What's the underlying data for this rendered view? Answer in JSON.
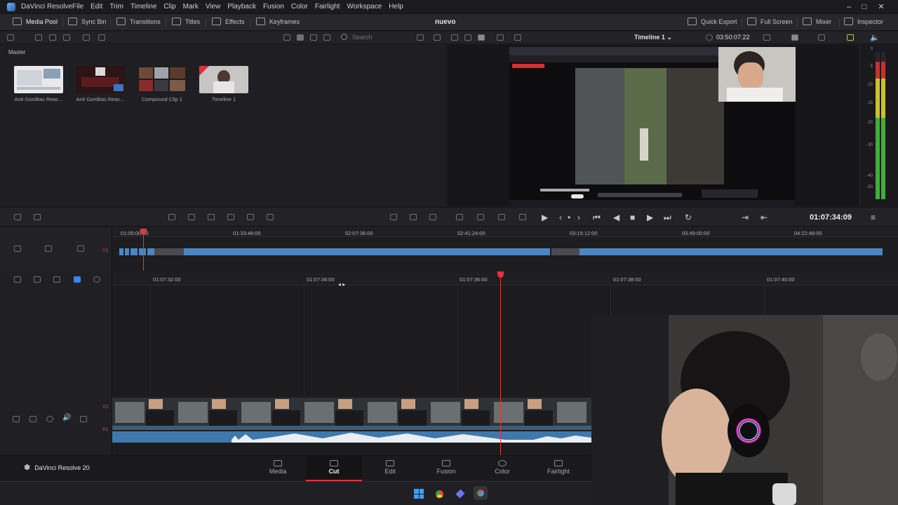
{
  "app": {
    "title": "DaVinci Resolve",
    "menu": [
      "File",
      "Edit",
      "Trim",
      "Timeline",
      "Clip",
      "Mark",
      "View",
      "Playback",
      "Fusion",
      "Color",
      "Fairlight",
      "Workspace",
      "Help"
    ],
    "window_controls": [
      "minimize-icon",
      "maximize-icon",
      "close-icon"
    ]
  },
  "toolbar": {
    "media_pool": "Media Pool",
    "sync_bin": "Sync Bin",
    "transitions": "Transitions",
    "titles": "Titles",
    "effects": "Effects",
    "keyframes": "Keyframes",
    "project_title": "nuevo",
    "quick_export": "Quick Export",
    "full_screen": "Full Screen",
    "mixer": "Mixer",
    "inspector": "Inspector"
  },
  "subbar": {
    "search_placeholder": "Search",
    "timeline_name": "Timeline 1",
    "timecode": "03:50:07:22"
  },
  "media_pool": {
    "bin": "Master",
    "clips": [
      {
        "name": "Anti Gorditas Reac..."
      },
      {
        "name": "Anti Gorditas Reac..."
      },
      {
        "name": "Compound Clip 1"
      },
      {
        "name": "Timeline 1"
      }
    ]
  },
  "viewer": {
    "meter_scale": [
      "0",
      "-5",
      "-10",
      "-15",
      "-20",
      "-30",
      "-40",
      "-50"
    ]
  },
  "transport": {
    "timecode": "01:07:34:09"
  },
  "upper_ruler": {
    "labels": [
      "01:00:00:00",
      "01:33:48:00",
      "02:07:36:00",
      "02:41:24:00",
      "03:15:12:00",
      "03:49:00:00",
      "04:22:48:00"
    ],
    "track": "V1"
  },
  "lower_ruler": {
    "labels": [
      "01:07:32:00",
      "01:07:34:00",
      "01:07:36:00",
      "01:07:38:00",
      "01:07:40:00"
    ],
    "video_track": "V1",
    "audio_track": "A1"
  },
  "pages": {
    "brand": "DaVinci Resolve 20",
    "tabs": [
      "Media",
      "Cut",
      "Edit",
      "Fusion",
      "Color",
      "Fairlight"
    ],
    "active": "Cut"
  },
  "colors": {
    "playhead": "#e8333a",
    "clip_blue": "#4a86c4",
    "accent": "#3b82f6"
  }
}
